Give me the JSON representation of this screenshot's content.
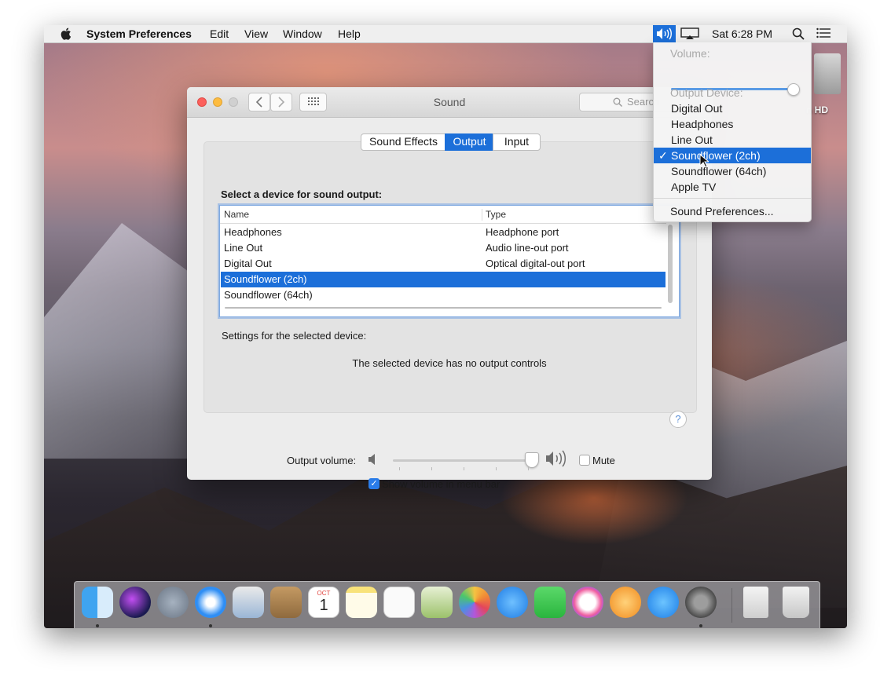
{
  "menubar": {
    "app_name": "System Preferences",
    "menus": [
      "Edit",
      "View",
      "Window",
      "Help"
    ],
    "clock": "Sat 6:28 PM",
    "icons": [
      "apple-icon",
      "volume-icon",
      "airplay-icon",
      "spotlight-search-icon",
      "notification-center-icon"
    ]
  },
  "volume_menu": {
    "volume_label": "Volume:",
    "volume_level": 0.98,
    "output_header": "Output Device:",
    "devices": [
      "Digital Out",
      "Headphones",
      "Line Out",
      "Soundflower (2ch)",
      "Soundflower (64ch)",
      "Apple TV"
    ],
    "selected_device": "Soundflower (2ch)",
    "check_glyph": "✓",
    "preferences_item": "Sound Preferences..."
  },
  "desktop": {
    "drive_label": "n HD"
  },
  "window": {
    "title": "Sound",
    "search_placeholder": "Search",
    "tabs": [
      "Sound Effects",
      "Output",
      "Input"
    ],
    "active_tab": "Output",
    "select_prompt": "Select a device for sound output:",
    "table": {
      "columns": [
        "Name",
        "Type"
      ],
      "rows": [
        {
          "name": "Headphones",
          "type": "Headphone port"
        },
        {
          "name": "Line Out",
          "type": "Audio line-out port"
        },
        {
          "name": "Digital Out",
          "type": "Optical digital-out port"
        },
        {
          "name": "Soundflower (2ch)",
          "type": ""
        },
        {
          "name": "Soundflower (64ch)",
          "type": ""
        }
      ],
      "selected_row": "Soundflower (2ch)"
    },
    "settings_label": "Settings for the selected device:",
    "no_controls_text": "The selected device has no output controls",
    "help_glyph": "?",
    "output_volume_label": "Output volume:",
    "output_volume_level": 0.97,
    "mute_label": "Mute",
    "mute_checked": false,
    "show_volume_label": "Show volume in menu bar",
    "show_volume_checked": true
  },
  "dock": {
    "apps": [
      "finder-icon",
      "siri-icon",
      "launchpad-icon",
      "safari-icon",
      "mail-icon",
      "contacts-icon",
      "calendar-icon",
      "notes-icon",
      "reminders-icon",
      "preview-icon",
      "photos-icon",
      "messages-icon",
      "facetime-icon",
      "itunes-icon",
      "ibooks-icon",
      "app-store-icon",
      "system-preferences-icon",
      "downloads-stack-icon",
      "trash-icon"
    ],
    "calendar_month": "OCT",
    "calendar_day": "1"
  },
  "colors": {
    "accent": "#1c6fd9",
    "close": "#fc605c",
    "minimize": "#fdbc40",
    "zoom_disabled": "#d0d0d0"
  }
}
